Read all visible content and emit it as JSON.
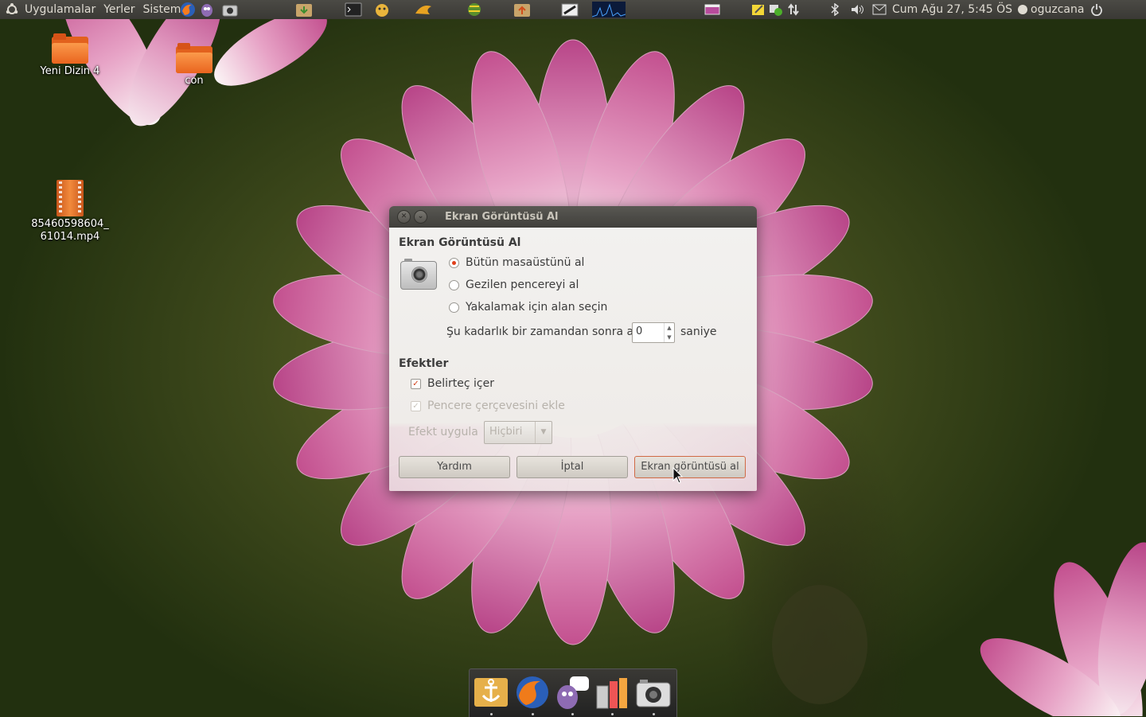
{
  "top_panel": {
    "menu": [
      "Uygulamalar",
      "Yerler",
      "Sistem"
    ],
    "clock": "Cum Ağu 27,  5:45 ÖS",
    "user": "oguzcana"
  },
  "desktop": {
    "icons": [
      {
        "label": "Yeni Dizin 4"
      },
      {
        "label": "con"
      },
      {
        "label_line1": "85460598604_",
        "label_line2": "61014.mp4"
      }
    ]
  },
  "dialog": {
    "title": "Ekran Görüntüsü Al",
    "section_capture": "Ekran Görüntüsü Al",
    "options": [
      {
        "label": "Bütün masaüstünü al",
        "selected": true
      },
      {
        "label": "Gezilen pencereyi al",
        "selected": false
      },
      {
        "label": "Yakalamak için alan seçin",
        "selected": false
      }
    ],
    "delay_label": "Şu kadarlık bir zamandan sonra al:",
    "delay_value": "0",
    "delay_unit": "saniye",
    "section_effects": "Efektler",
    "include_pointer": "Belirteç içer",
    "include_border": "Pencere çerçevesini ekle",
    "apply_effect_label": "Efekt uygula",
    "apply_effect_value": "Hiçbiri",
    "buttons": {
      "help": "Yardım",
      "cancel": "İptal",
      "take": "Ekran görüntüsü al"
    },
    "accent_color": "#e0401c"
  },
  "dock": {
    "items": [
      "anchor-icon",
      "firefox-icon",
      "pidgin-icon",
      "archive-icon",
      "camera-icon"
    ]
  }
}
